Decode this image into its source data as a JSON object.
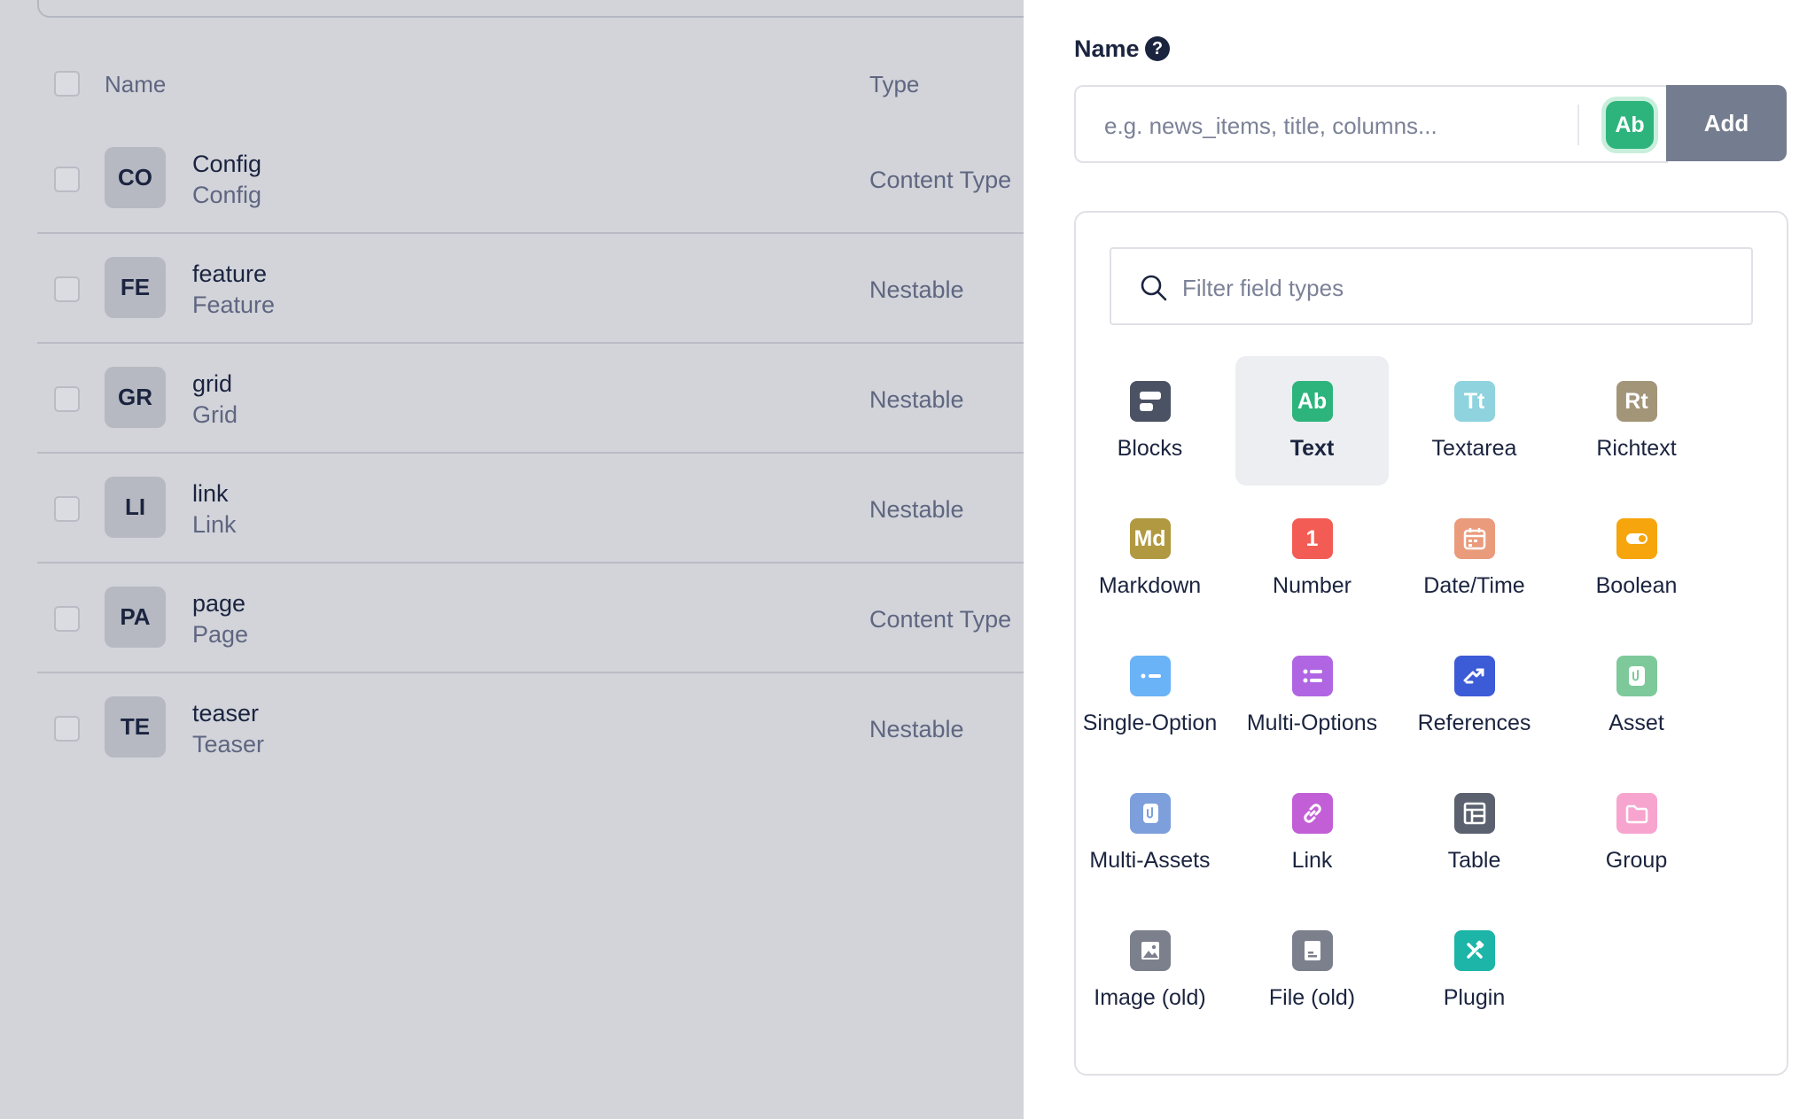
{
  "list": {
    "header": {
      "name": "Name",
      "type": "Type"
    },
    "rows": [
      {
        "initials": "CO",
        "title": "Config",
        "subtitle": "Config",
        "type": "Content Type"
      },
      {
        "initials": "FE",
        "title": "feature",
        "subtitle": "Feature",
        "type": "Nestable"
      },
      {
        "initials": "GR",
        "title": "grid",
        "subtitle": "Grid",
        "type": "Nestable"
      },
      {
        "initials": "LI",
        "title": "link",
        "subtitle": "Link",
        "type": "Nestable"
      },
      {
        "initials": "PA",
        "title": "page",
        "subtitle": "Page",
        "type": "Content Type"
      },
      {
        "initials": "TE",
        "title": "teaser",
        "subtitle": "Teaser",
        "type": "Nestable"
      }
    ]
  },
  "panel": {
    "name_label": "Name",
    "help_glyph": "?",
    "name_placeholder": "e.g. news_items, title, columns...",
    "selected_chip": "Ab",
    "add_label": "Add",
    "filter_placeholder": "Filter field types",
    "selected_type": "Text",
    "field_types": [
      {
        "label": "Blocks",
        "icon": "blocks-icon",
        "glyph": "",
        "color": "#4b5263"
      },
      {
        "label": "Text",
        "icon": "text-icon",
        "glyph": "Ab",
        "color": "#2db47c"
      },
      {
        "label": "Textarea",
        "icon": "textarea-icon",
        "glyph": "Tt",
        "color": "#8ed3de"
      },
      {
        "label": "Richtext",
        "icon": "richtext-icon",
        "glyph": "Rt",
        "color": "#a39578"
      },
      {
        "label": "Markdown",
        "icon": "markdown-icon",
        "glyph": "Md",
        "color": "#b09940"
      },
      {
        "label": "Number",
        "icon": "number-icon",
        "glyph": "1",
        "color": "#f25c54"
      },
      {
        "label": "Date/Time",
        "icon": "calendar-icon",
        "glyph": "",
        "color": "#ea9b7c"
      },
      {
        "label": "Boolean",
        "icon": "toggle-icon",
        "glyph": "",
        "color": "#f6a50c"
      },
      {
        "label": "Single-Option",
        "icon": "single-option-icon",
        "glyph": "",
        "color": "#6ab3f7"
      },
      {
        "label": "Multi-Options",
        "icon": "multi-options-icon",
        "glyph": "",
        "color": "#b066e3"
      },
      {
        "label": "References",
        "icon": "references-icon",
        "glyph": "",
        "color": "#3c5bd6"
      },
      {
        "label": "Asset",
        "icon": "asset-icon",
        "glyph": "",
        "color": "#7ec99a"
      },
      {
        "label": "Multi-Assets",
        "icon": "multi-assets-icon",
        "glyph": "",
        "color": "#7d9fdb"
      },
      {
        "label": "Link",
        "icon": "link-icon",
        "glyph": "",
        "color": "#c25fd6"
      },
      {
        "label": "Table",
        "icon": "table-icon",
        "glyph": "",
        "color": "#5b616f"
      },
      {
        "label": "Group",
        "icon": "folder-icon",
        "glyph": "",
        "color": "#f7a5cf"
      },
      {
        "label": "Image (old)",
        "icon": "image-icon",
        "glyph": "",
        "color": "#7c808c"
      },
      {
        "label": "File (old)",
        "icon": "file-icon",
        "glyph": "",
        "color": "#7c808c"
      },
      {
        "label": "Plugin",
        "icon": "plugin-icon",
        "glyph": "",
        "color": "#1cb5a8"
      }
    ]
  }
}
